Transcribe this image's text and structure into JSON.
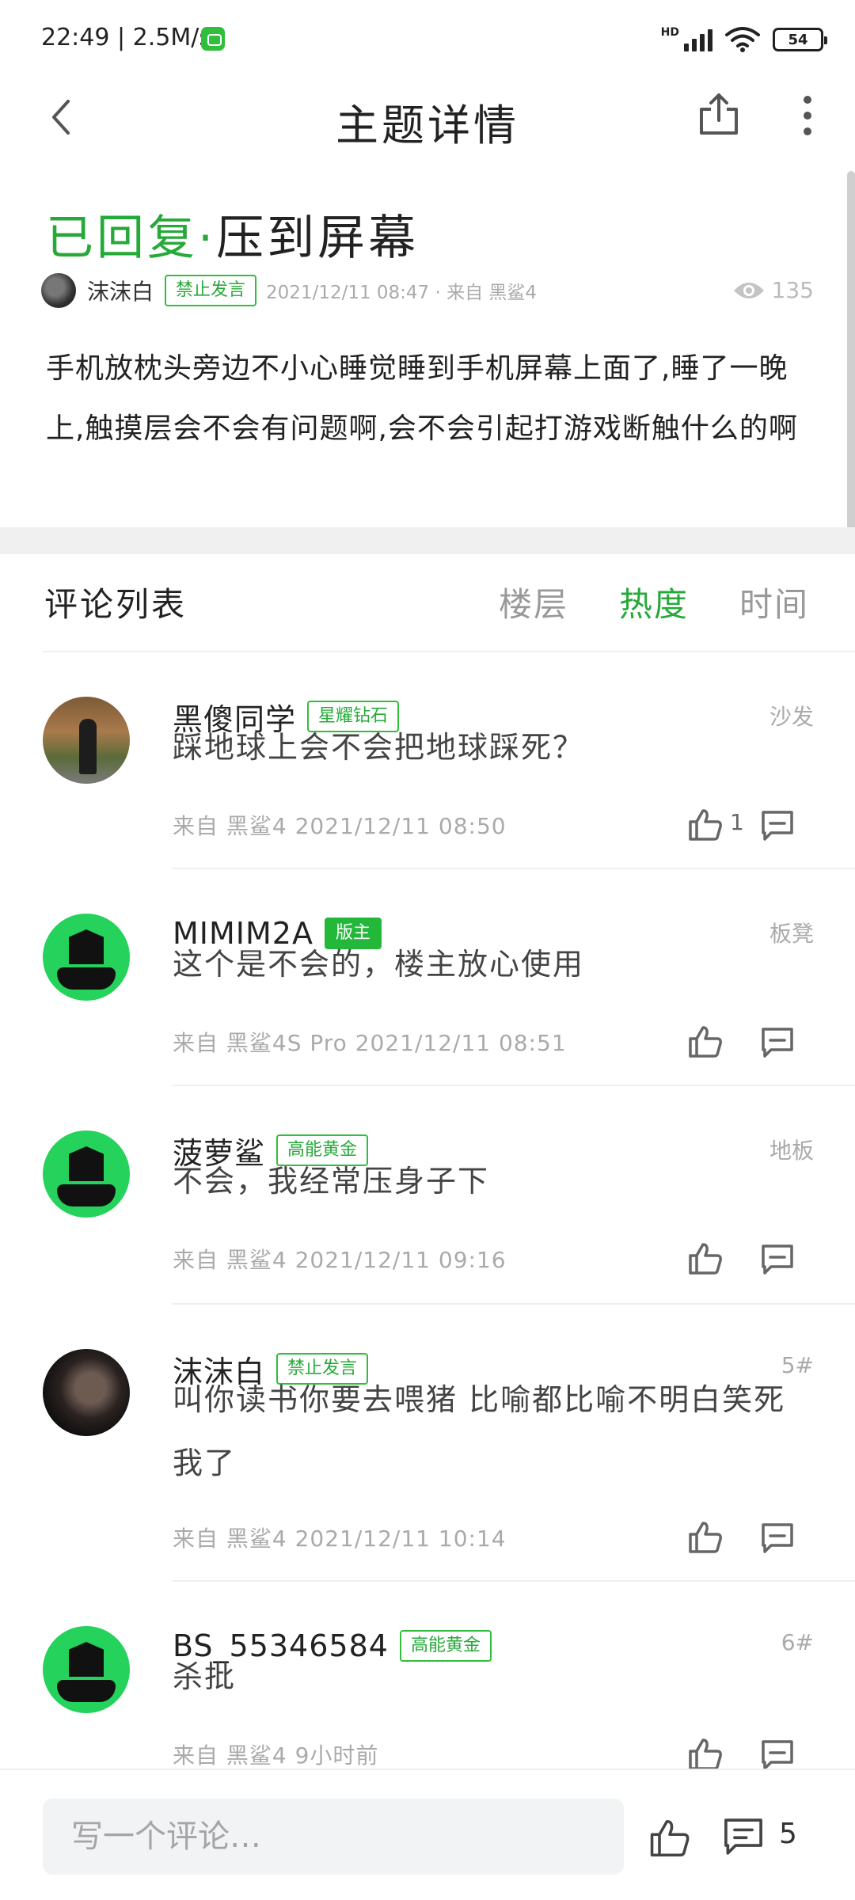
{
  "status_bar": {
    "time": "22:49 | 2.5M/s",
    "network": "HD",
    "battery": "54"
  },
  "header": {
    "title": "主题详情",
    "icons": [
      "back-icon",
      "share-icon",
      "more-icon"
    ]
  },
  "post": {
    "status": "已回复·",
    "title": "压到屏幕",
    "author": "沫沫白",
    "badge": "禁止发言",
    "meta": "2021/12/11 08:47 · 来自 黑鲨4",
    "views": "135",
    "body": "手机放枕头旁边不小心睡觉睡到手机屏幕上面了,睡了一晚上,触摸层会不会有问题啊,会不会引起打游戏断触什么的啊"
  },
  "comments_header": {
    "title": "评论列表",
    "tabs": [
      "楼层",
      "热度",
      "时间"
    ],
    "active_tab": "热度"
  },
  "comments": [
    {
      "name": "黑傻同学",
      "badge": "星耀钻石",
      "floor": "沙发",
      "text": "踩地球上会不会把地球踩死？",
      "meta": "来自 黑鲨4  2021/12/11 08:50",
      "likes": "1"
    },
    {
      "name": "MIMIM2A",
      "badge": "版主",
      "floor": "板凳",
      "text": "这个是不会的，楼主放心使用",
      "meta": "来自 黑鲨4S Pro  2021/12/11 08:51",
      "likes": ""
    },
    {
      "name": "菠萝鲨",
      "badge": "高能黄金",
      "floor": "地板",
      "text": "不会，我经常压身子下",
      "meta": "来自 黑鲨4  2021/12/11 09:16",
      "likes": ""
    },
    {
      "name": "沫沫白",
      "badge": "禁止发言",
      "floor": "5#",
      "text": "叫你读书你要去喂猪 比喻都比喻不明白笑死我了",
      "meta": "来自 黑鲨4  2021/12/11 10:14",
      "likes": ""
    },
    {
      "name": "BS_55346584",
      "badge": "高能黄金",
      "floor": "6#",
      "text": "杀批",
      "meta": "来自 黑鲨4  9小时前",
      "likes": ""
    }
  ],
  "bottom_bar": {
    "placeholder": "写一个评论…",
    "comment_count": "5"
  },
  "colors": {
    "accent": "#27a93a",
    "default_avatar": "#24d25c"
  }
}
